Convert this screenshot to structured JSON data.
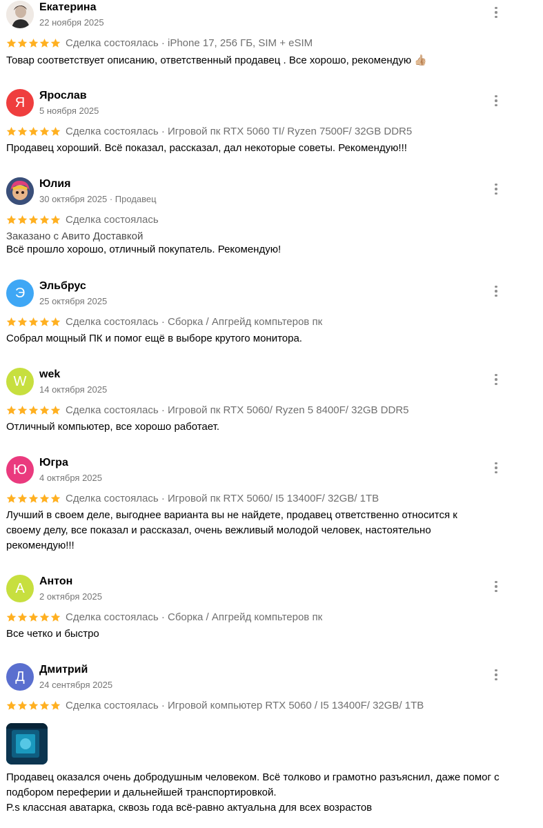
{
  "colors": {
    "star": "#ffb021",
    "meta_text": "#757575",
    "deal_text": "#6f6f6f"
  },
  "reviews": [
    {
      "author": "Екатерина",
      "date": "22 ноября 2025",
      "avatar": {
        "type": "photo",
        "icon": "user-photo-icon"
      },
      "rating": 5,
      "deal": "Сделка состоялась · iPhone 17, 256 ГБ, SIM + eSIM",
      "text": "Товар соответствует описанию, ответственный продавец . Все хорошо, рекомендую 👍🏼"
    },
    {
      "author": "Ярослав",
      "date": "5 ноября 2025",
      "avatar": {
        "type": "letter",
        "letter": "Я",
        "color": "#ef3e3e"
      },
      "rating": 5,
      "deal": "Сделка состоялась · Игровой пк RTX 5060 TI/ Ryzen 7500F/ 32GB DDR5",
      "text": "Продавец хороший. Всё показал, рассказал, дал некоторые советы. Рекомендую!!!"
    },
    {
      "author": "Юлия",
      "date": "30 октября 2025",
      "role": "Продавец",
      "avatar": {
        "type": "photo",
        "icon": "user-photo-icon"
      },
      "rating": 5,
      "deal": "Сделка состоялась",
      "delivery": "Заказано с Авито Доставкой",
      "text": "Всё прошло хорошо, отличный покупатель. Рекомендую!"
    },
    {
      "author": "Эльбрус",
      "date": "25 октября 2025",
      "avatar": {
        "type": "letter",
        "letter": "Э",
        "color": "#3fa7f5"
      },
      "rating": 5,
      "deal": "Сделка состоялась · Сборка / Апгрейд компьтеров пк",
      "text": "Собрал мощный ПК и помог ещё в выборе крутого монитора."
    },
    {
      "author": "wek",
      "date": "14 октября 2025",
      "avatar": {
        "type": "letter",
        "letter": "W",
        "color": "#c7df3f"
      },
      "rating": 5,
      "deal": "Сделка состоялась · Игровой пк RTX 5060/ Ryzen 5 8400F/ 32GB DDR5",
      "text": "Отличный компьютер, все хорошо работает."
    },
    {
      "author": "Югра",
      "date": "4 октября 2025",
      "avatar": {
        "type": "letter",
        "letter": "Ю",
        "color": "#ea3a7e"
      },
      "rating": 5,
      "deal": "Сделка состоялась · Игровой пк RTX 5060/ I5 13400F/ 32GB/ 1TB",
      "text": "Лучший в своем деле, выгоднее варианта вы не найдете, продавец ответственно относится к своему делу, все показал и рассказал, очень вежливый молодой человек, настоятельно рекомендую!!!"
    },
    {
      "author": "Антон",
      "date": "2 октября 2025",
      "avatar": {
        "type": "letter",
        "letter": "А",
        "color": "#c7df3f"
      },
      "rating": 5,
      "deal": "Сделка состоялась · Сборка / Апгрейд компьтеров пк",
      "text": "Все четко и быстро"
    },
    {
      "author": "Дмитрий",
      "date": "24 сентября 2025",
      "avatar": {
        "type": "letter",
        "letter": "Д",
        "color": "#5a6fcf"
      },
      "rating": 5,
      "deal": "Сделка состоялась · Игровой компьютер RTX 5060 / I5 13400F/ 32GB/ 1TB",
      "has_photo": true,
      "text": "Продавец оказался очень добродушным человеком. Всё толково и грамотно разъяснил, даже помог с подбором переферии и дальнейшей транспортировкой.\nP.s классная аватарка, сквозь года всё-равно актуальна для всех возрастов"
    }
  ]
}
